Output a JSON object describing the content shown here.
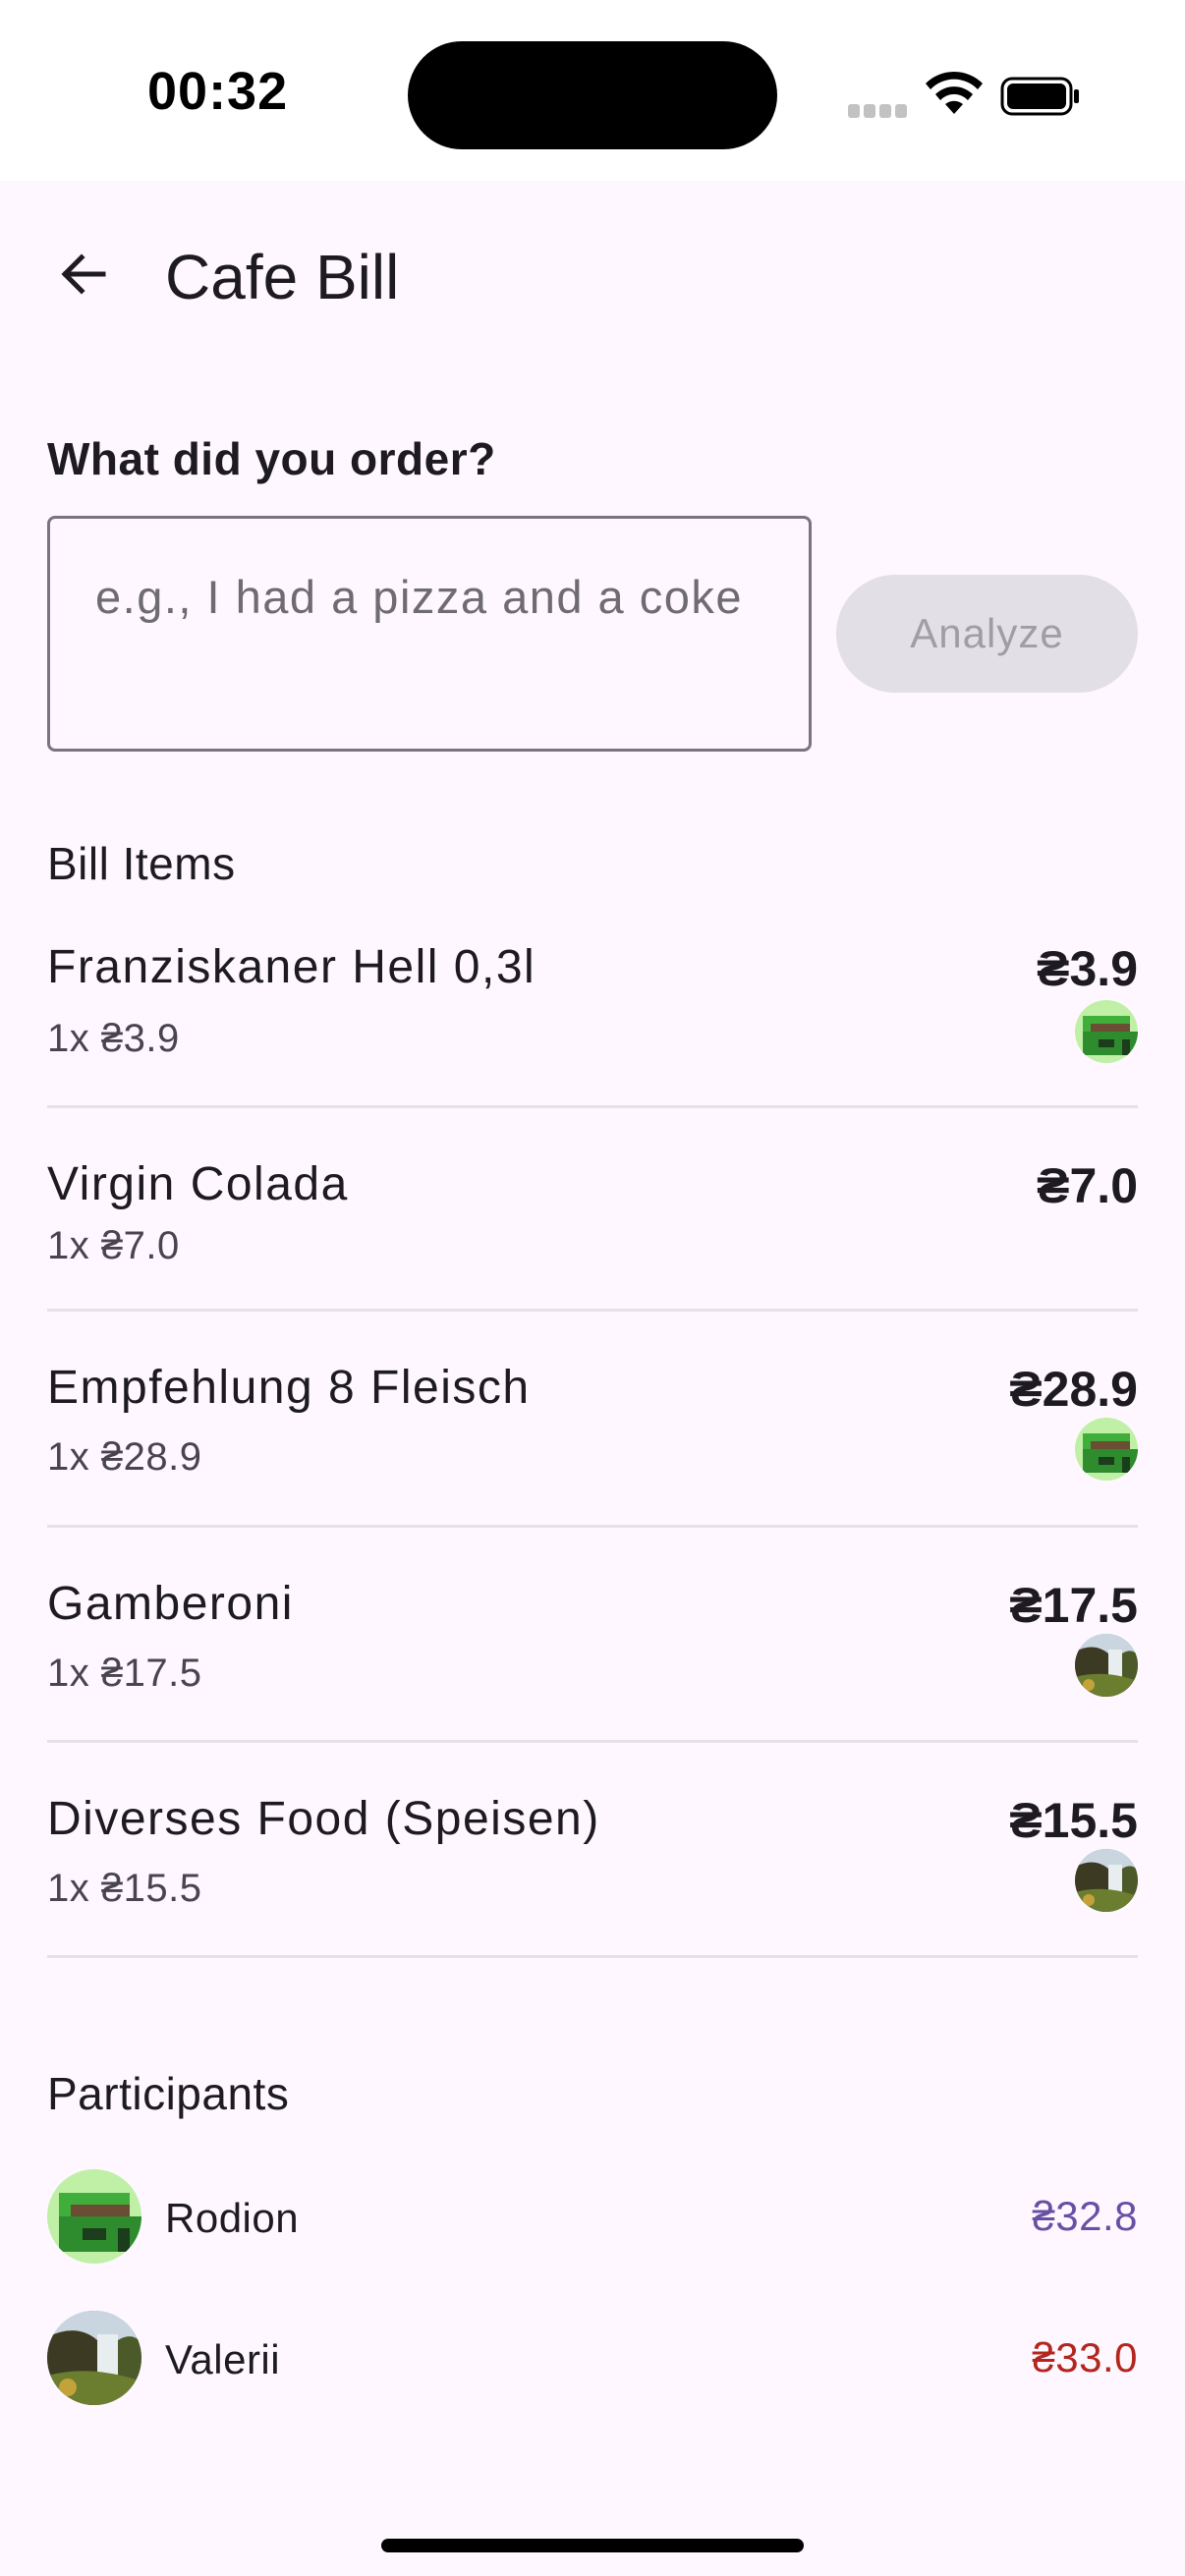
{
  "status_bar": {
    "time": "00:32"
  },
  "header": {
    "title": "Cafe Bill",
    "back_icon": "arrow-back-icon"
  },
  "order": {
    "question": "What did you order?",
    "placeholder": "e.g., I had a pizza and a coke",
    "analyze_label": "Analyze"
  },
  "bill": {
    "title": "Bill Items",
    "items": [
      {
        "name": "Franziskaner Hell 0,3l",
        "qty": "1x ₴3.9",
        "total": "₴3.9",
        "assignee": "Rodion"
      },
      {
        "name": "Virgin Colada",
        "qty": "1x ₴7.0",
        "total": "₴7.0",
        "assignee": ""
      },
      {
        "name": "Empfehlung 8 Fleisch",
        "qty": "1x ₴28.9",
        "total": "₴28.9",
        "assignee": "Rodion"
      },
      {
        "name": "Gamberoni",
        "qty": "1x ₴17.5",
        "total": "₴17.5",
        "assignee": "Valerii"
      },
      {
        "name": "Diverses Food (Speisen)",
        "qty": "1x ₴15.5",
        "total": "₴15.5",
        "assignee": "Valerii"
      }
    ]
  },
  "participants": {
    "title": "Participants",
    "list": [
      {
        "name": "Rodion",
        "amount": "₴32.8",
        "amount_color": "#6750a4"
      },
      {
        "name": "Valerii",
        "amount": "₴33.0",
        "amount_color": "#b3261e"
      }
    ]
  },
  "colors": {
    "background": "#fef7ff",
    "accent": "#6750a4",
    "error": "#b3261e"
  }
}
